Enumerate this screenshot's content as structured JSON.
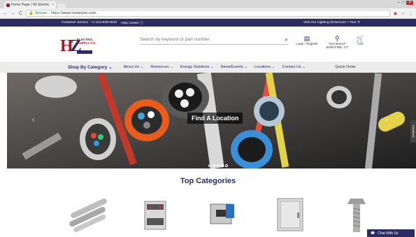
{
  "browser": {
    "tab_title": "Home Page | HZ Electric",
    "tab_close": "×",
    "secure_label": "Secure",
    "url_scheme": "https://",
    "url_host": "www.hzelectric.com"
  },
  "topbar": {
    "customer_service": "Customer Service : +1-413-848-0910",
    "help_center": "Help Center",
    "showroom": "Visit Our Lighting Showroom > Tour"
  },
  "logo": {
    "h": "H",
    "z": "Z",
    "line1": "ELECTRIC",
    "line2": "SUPPLY CO."
  },
  "search": {
    "placeholder": "Search by keyword or part number"
  },
  "header_icons": {
    "login": "Login / Register",
    "branch_label": "Your Branch",
    "branch_value": "BURLFIRD, CT",
    "cart": "Cart"
  },
  "menu": {
    "shop": "Shop By Category",
    "items": [
      "About Us",
      "Resources",
      "Energy Solutions",
      "News/Events",
      "Locations",
      "Contact Us"
    ],
    "quick_order": "Quick Order"
  },
  "hero": {
    "caption": "Find A Location",
    "slide_count": 5,
    "active_slide": 4
  },
  "feedback": "Feedback",
  "categories": {
    "title": "Top Categories"
  },
  "chat": {
    "label": "Chat With Us"
  },
  "colors": {
    "brand_navy": "#2b2c63",
    "brand_red": "#b5121b"
  }
}
